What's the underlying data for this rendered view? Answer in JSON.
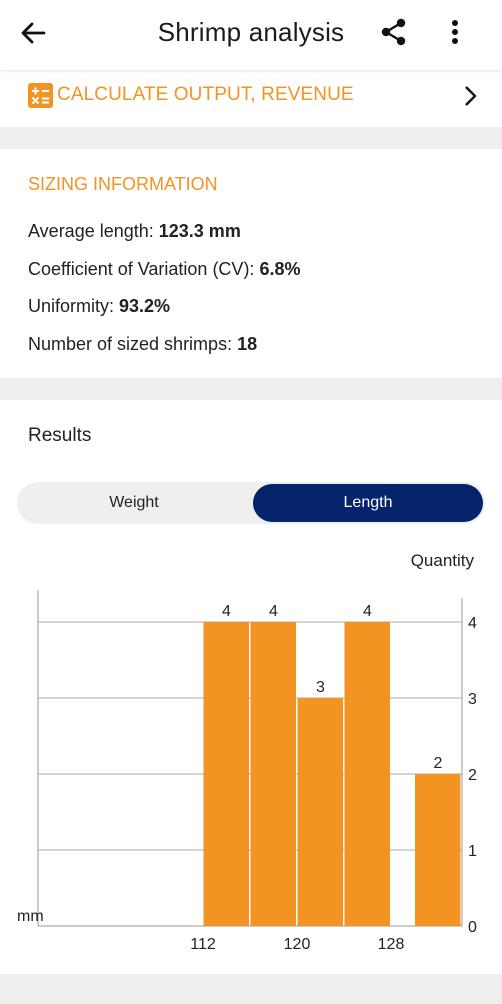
{
  "header": {
    "title": "Shrimp analysis",
    "back_icon": "arrow-left-icon",
    "share_icon": "share-icon",
    "more_icon": "more-vertical-icon"
  },
  "calculate": {
    "label": "CALCULATE OUTPUT, REVENUE",
    "icon": "calculator-icon",
    "chevron_icon": "chevron-right-icon",
    "accent": "#f29322"
  },
  "sizing": {
    "heading": "SIZING INFORMATION",
    "rows": [
      {
        "label": "Average length: ",
        "value": "123.3 mm"
      },
      {
        "label": "Coefficient of Variation (CV): ",
        "value": "6.8%"
      },
      {
        "label": "Uniformity: ",
        "value": "93.2%"
      },
      {
        "label": "Number of sized shrimps: ",
        "value": "18"
      }
    ]
  },
  "results": {
    "title": "Results",
    "tabs": [
      {
        "label": "Weight",
        "selected": false
      },
      {
        "label": "Length",
        "selected": true
      }
    ],
    "selected_color": "#04236b"
  },
  "chart_data": {
    "type": "bar",
    "xlabel": "mm",
    "ylabel": "Quantity",
    "bin_width": 4,
    "bins": [
      {
        "start": 112,
        "value": 4
      },
      {
        "start": 116,
        "value": 4
      },
      {
        "start": 120,
        "value": 3
      },
      {
        "start": 124,
        "value": 4
      },
      {
        "start": 130,
        "value": 2
      }
    ],
    "xticks": [
      "112",
      "120",
      "128"
    ],
    "yticks": [
      "0",
      "1",
      "2",
      "3",
      "4"
    ],
    "ylim": [
      0,
      4.4
    ],
    "bar_color": "#f29322",
    "grid": true,
    "y_axis_side": "right"
  }
}
